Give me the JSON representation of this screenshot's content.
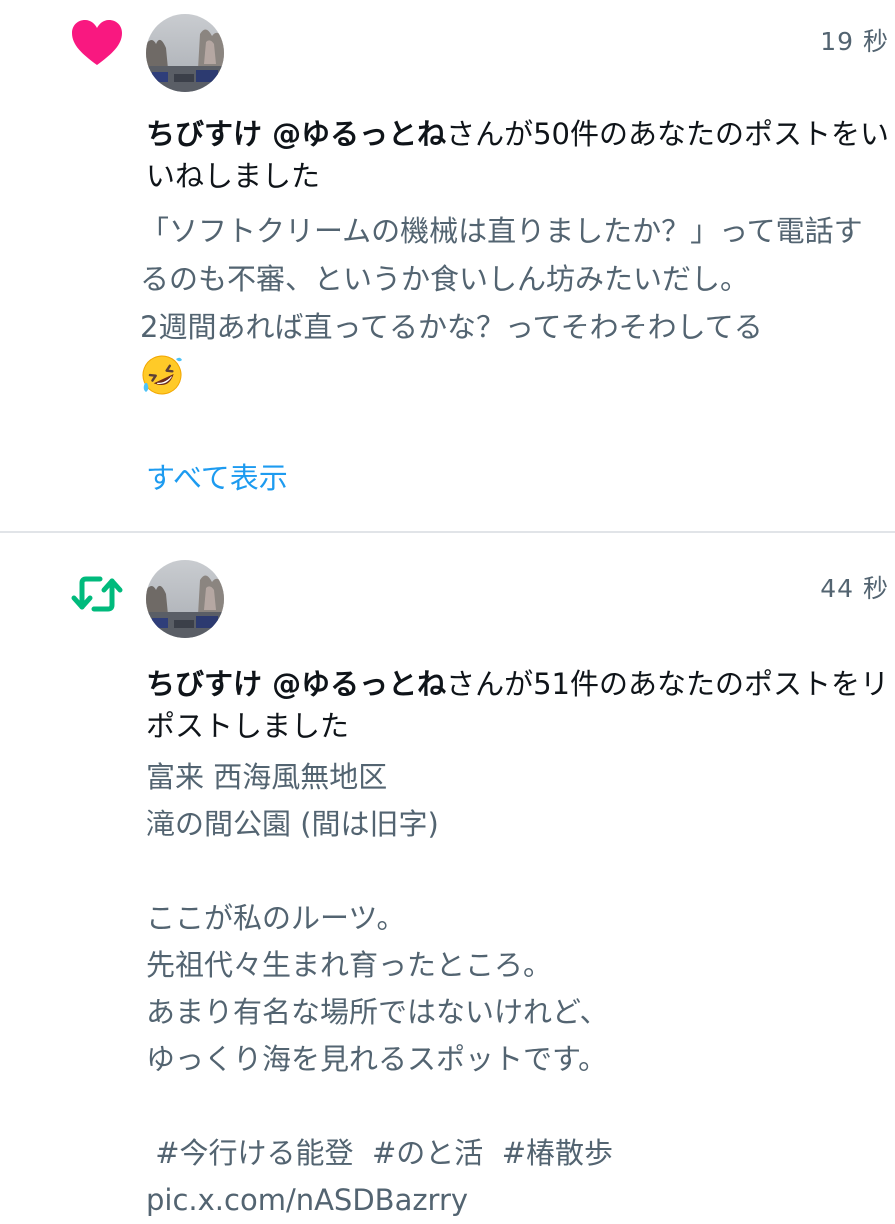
{
  "notifications": [
    {
      "type": "like",
      "icon": "heart-icon",
      "icon_color": "#f91880",
      "timestamp": "19 秒",
      "user": "ちびすけ @ゆるっとね",
      "action_text": "さんが50件のあなたのポストをいいねしました",
      "post_text": "「ソフトクリームの機械は直りましたか？」って電話するのも不審、というか食いしん坊みたいだし。\n2週間あれば直ってるかな？ってそわそわしてる",
      "post_emoji": "rolling-on-floor-laughing-emoji",
      "show_all": "すべて表示"
    },
    {
      "type": "repost",
      "icon": "repost-icon",
      "icon_color": "#00ba7c",
      "timestamp": "44 秒",
      "user": "ちびすけ @ゆるっとね",
      "action_text": "さんが51件のあなたのポストをリポストしました",
      "post_text": "富来 西海風無地区\n滝の間公園 (間は旧字)\n\nここが私のルーツ。\n先祖代々生まれ育ったところ。\nあまり有名な場所ではないけれど、\nゆっくり海を見れるスポットです。\n\n #今行ける能登  #のと活  #椿散歩 pic.x.com/nASDBazrry"
    }
  ],
  "colors": {
    "link": "#1d9bf0",
    "secondary_text": "#536471",
    "primary_text": "#0f1419",
    "divider": "#e1e4e8"
  }
}
